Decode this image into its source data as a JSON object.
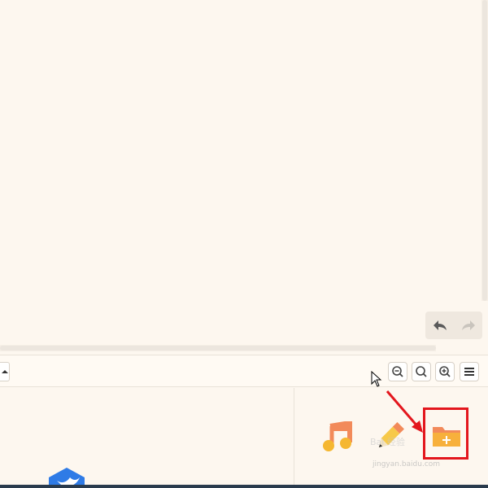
{
  "canvas": {
    "undo_icon": "undo-arrow-icon",
    "redo_icon": "redo-arrow-icon"
  },
  "toolbar": {
    "collapse_icon": "caret-up-icon",
    "zoom_out_icon": "zoom-out-icon",
    "zoom_reset_icon": "zoom-reset-icon",
    "zoom_in_icon": "zoom-in-icon",
    "menu_icon": "hamburger-menu-icon"
  },
  "apps": [
    {
      "name": "music-app-icon",
      "color": "#f5a623"
    },
    {
      "name": "pencil-app-icon",
      "color": "#f7c948"
    },
    {
      "name": "new-folder-icon",
      "color": "#f5a623"
    }
  ],
  "watermark": {
    "text": "Bai 经验",
    "sub": "jingyan.baidu.com"
  },
  "colors": {
    "highlight": "#e3161d",
    "background": "#fdf7ef"
  }
}
